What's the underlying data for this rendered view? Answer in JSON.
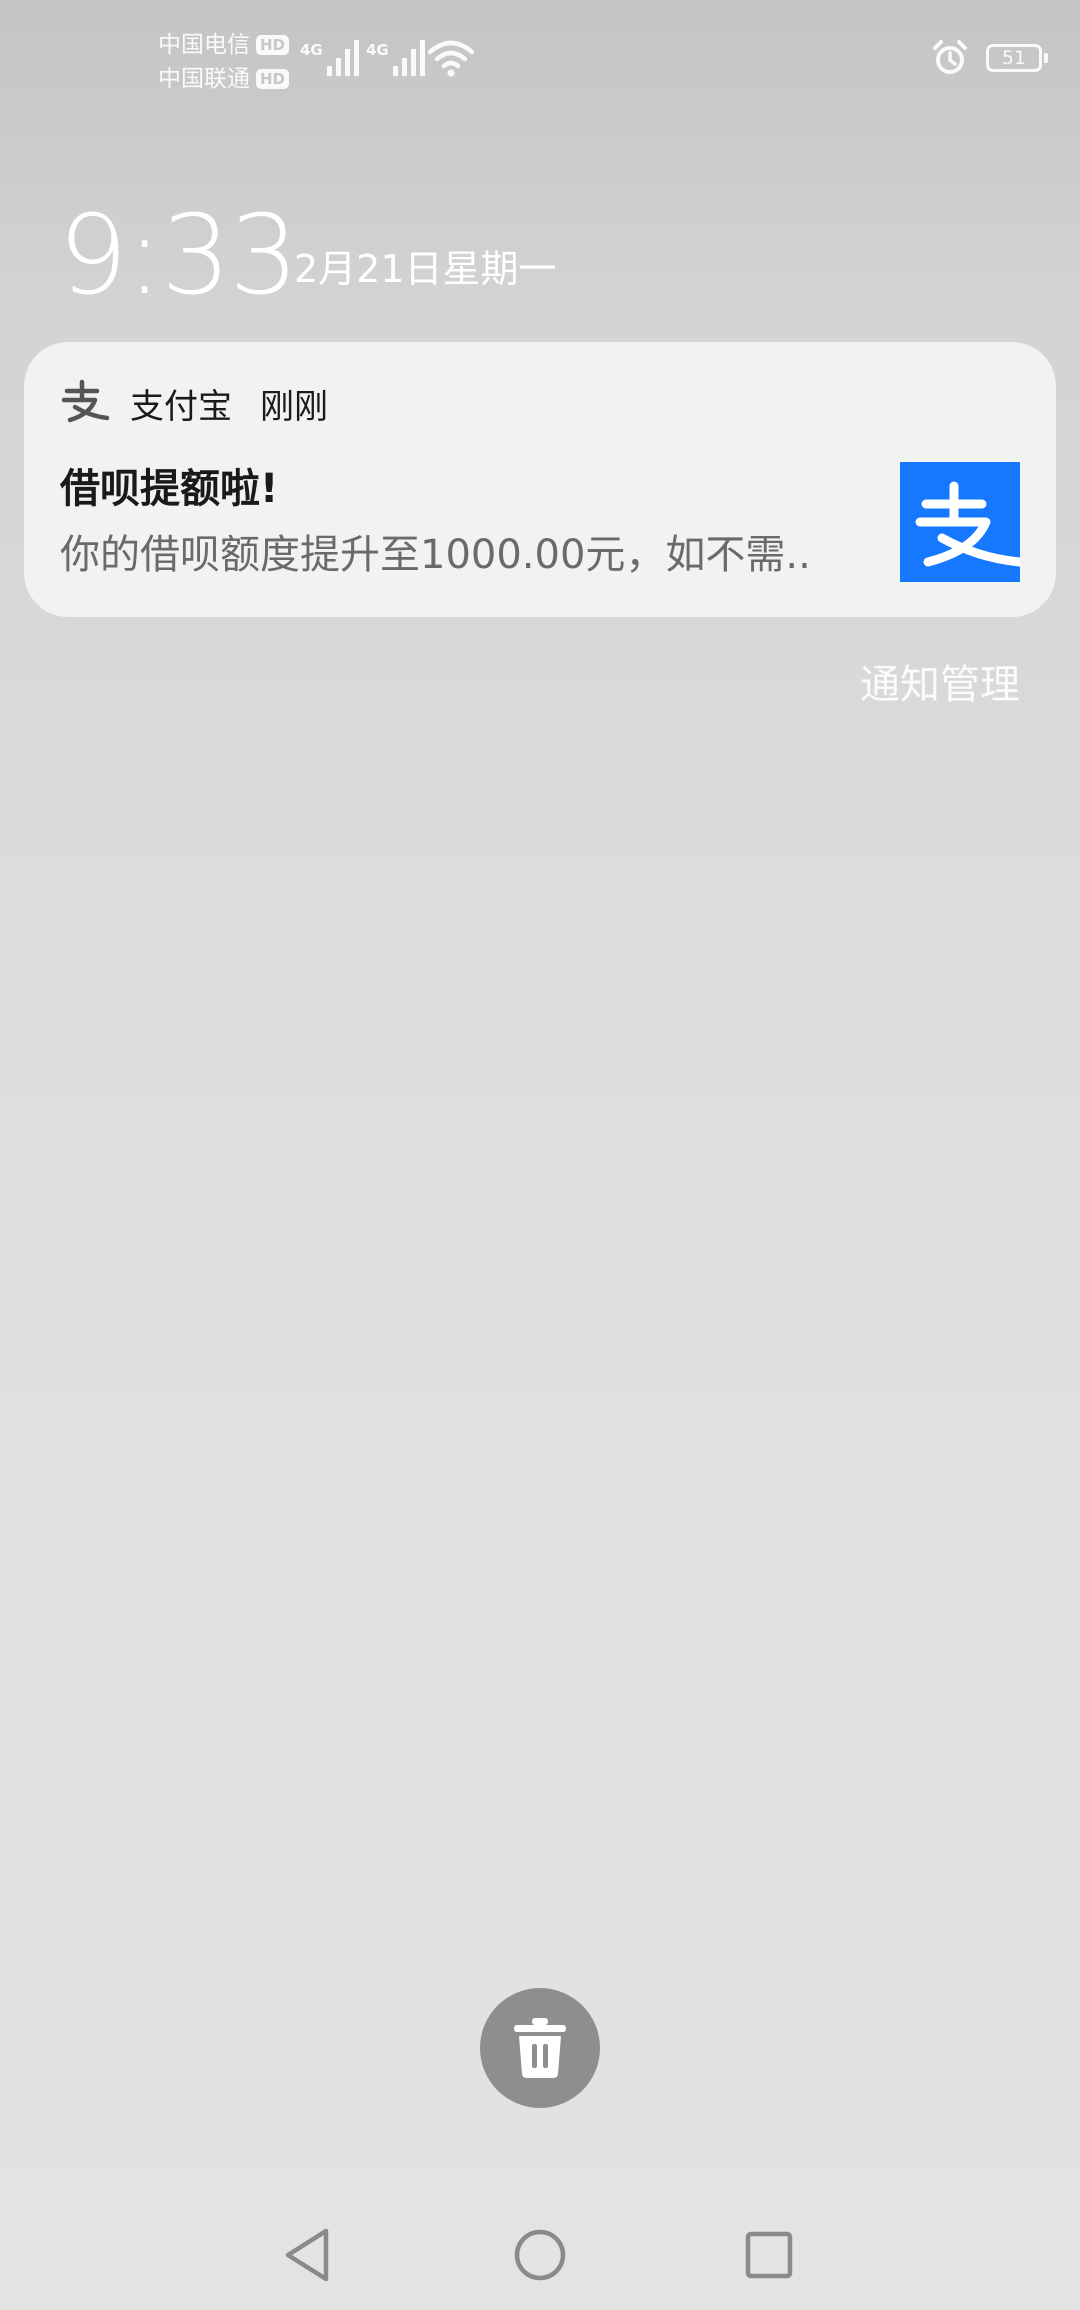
{
  "status_bar": {
    "carrier_1": "中国电信",
    "carrier_2": "中国联通",
    "hd_label": "HD",
    "net_type_1": "4G",
    "net_type_2": "4G",
    "battery_level": "51",
    "icons": [
      "signal-icon",
      "signal-icon",
      "wifi-icon",
      "alarm-icon",
      "battery-icon"
    ]
  },
  "lockscreen": {
    "time": "9:33",
    "date": "2月21日星期一"
  },
  "notification": {
    "app_name": "支付宝",
    "time": "刚刚",
    "title": "借呗提额啦!",
    "body": "你的借呗额度提升至1000.00元，如不需..",
    "accent_color": "#1677ff"
  },
  "notification_manage_label": "通知管理",
  "actions": {
    "clear_icon": "trash-icon"
  },
  "navigation": {
    "icons": [
      "back-icon",
      "home-icon",
      "recents-icon"
    ]
  }
}
